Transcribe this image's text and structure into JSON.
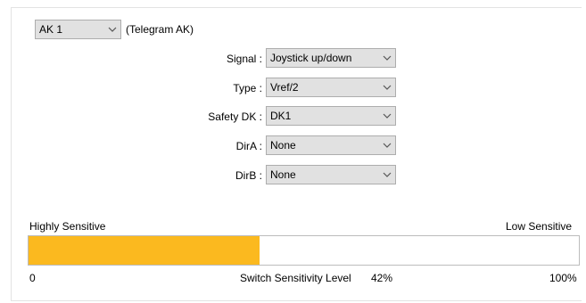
{
  "ak_select": {
    "value": "AK 1",
    "telegram_label": "(Telegram AK)"
  },
  "fields": [
    {
      "label": "Signal :",
      "value": "Joystick up/down"
    },
    {
      "label": "Type :",
      "value": "Vref/2"
    },
    {
      "label": "Safety DK :",
      "value": "DK1"
    },
    {
      "label": "DirA :",
      "value": "None"
    },
    {
      "label": "DirB :",
      "value": "None"
    }
  ],
  "sensitivity": {
    "left_label": "Highly Sensitive",
    "right_label": "Low Sensitive",
    "min_label": "0",
    "max_label": "100%",
    "level_label": "Switch Sensitivity Level",
    "level_value": "42%",
    "level_percent": 42,
    "fill_color": "#fbb91f"
  },
  "icons": {
    "dropdown": "chevron-down-icon"
  }
}
